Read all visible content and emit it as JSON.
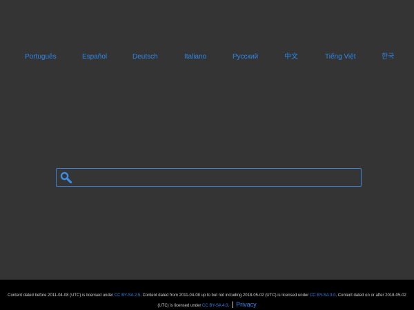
{
  "languages": [
    {
      "label": "Português"
    },
    {
      "label": "Español"
    },
    {
      "label": "Deutsch"
    },
    {
      "label": "Italiano"
    },
    {
      "label": "Русский"
    },
    {
      "label": "中文"
    },
    {
      "label": "Tiếng Việt"
    },
    {
      "label": "한국"
    }
  ],
  "search": {
    "icon": "search-icon",
    "value": "",
    "placeholder": ""
  },
  "footer": {
    "text1": "Content dated before 2011-04-08 (UTC) is licensed under ",
    "link1": "CC BY-SA 2.5",
    "text2": ". Content dated from 2011-04-08 up to but not including 2018-05-02 (UTC) is licensed under ",
    "link2": "CC BY-SA 3.0",
    "text3": ". Content dated on or after 2018-05-02",
    "text4": "(UTC) is licensed under ",
    "link3": "CC BY-SA 4.0",
    "text5": ".",
    "separator": "|",
    "privacy": "Privacy"
  },
  "colors": {
    "background": "#343434",
    "link": "#2f86e8",
    "footer_bg": "#000000",
    "search_border": "#3b82d6"
  }
}
